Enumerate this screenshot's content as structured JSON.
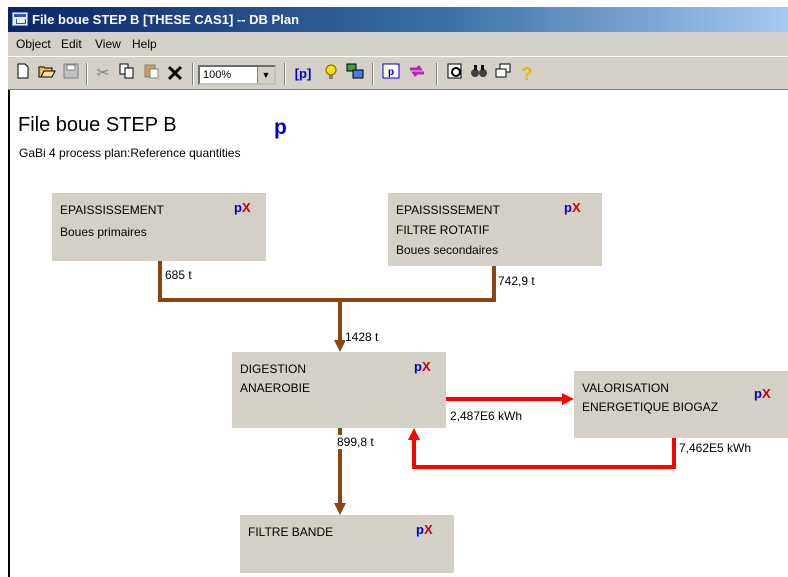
{
  "window": {
    "title": "File boue STEP B [THESE CAS1] -- DB Plan"
  },
  "menu": [
    "Object",
    "Edit",
    "View",
    "Help"
  ],
  "toolbar": {
    "zoom_value": "100%",
    "icons": [
      "new-icon",
      "open-icon",
      "save-icon",
      "cut-icon",
      "copy-icon",
      "paste-icon",
      "delete-icon",
      "zoom-select",
      "parameter-icon",
      "bulb-icon",
      "plan-icon",
      "parameter-explorer-icon",
      "swap-icon",
      "balance-icon",
      "search-icon",
      "windows-icon",
      "help-icon"
    ],
    "param_label": "[p]"
  },
  "plan": {
    "title": "File boue STEP B",
    "p_marker": "p",
    "subtitle": "GaBi 4 process plan:Reference quantities"
  },
  "processes": [
    {
      "id": "epaississement-1",
      "lines": [
        "EPAISSISSEMENT",
        "Boues primaires"
      ],
      "p": "p",
      "x": "X"
    },
    {
      "id": "epaississement-2",
      "lines": [
        "EPAISSISSEMENT",
        "FILTRE ROTATIF",
        "Boues secondaires"
      ],
      "p": "p",
      "x": "X"
    },
    {
      "id": "digestion",
      "lines": [
        "DIGESTION",
        "ANAEROBIE"
      ],
      "p": "p",
      "x": "X"
    },
    {
      "id": "valorisation",
      "lines": [
        "VALORISATION",
        "ENERGETIQUE BIOGAZ"
      ],
      "p": "p",
      "x": "X"
    },
    {
      "id": "filtre-bande",
      "lines": [
        "FILTRE BANDE"
      ],
      "p": "p",
      "x": "X"
    }
  ],
  "flows": [
    {
      "from": "epaississement-1",
      "to": "digestion",
      "label": "685 t",
      "color": "#8b4513"
    },
    {
      "from": "epaississement-2",
      "to": "digestion",
      "label": "742,9 t",
      "color": "#8b4513"
    },
    {
      "from": "merge",
      "to": "digestion",
      "label": "1428 t",
      "color": "#8b4513"
    },
    {
      "from": "digestion",
      "to": "filtre-bande",
      "label": "899,8 t",
      "color": "#8b4513"
    },
    {
      "from": "digestion",
      "to": "valorisation",
      "label": "2,487E6 kWh",
      "color": "#ff0000"
    },
    {
      "from": "valorisation",
      "to": "digestion",
      "label": "7,462E5 kWh",
      "color": "#ff0000"
    }
  ]
}
